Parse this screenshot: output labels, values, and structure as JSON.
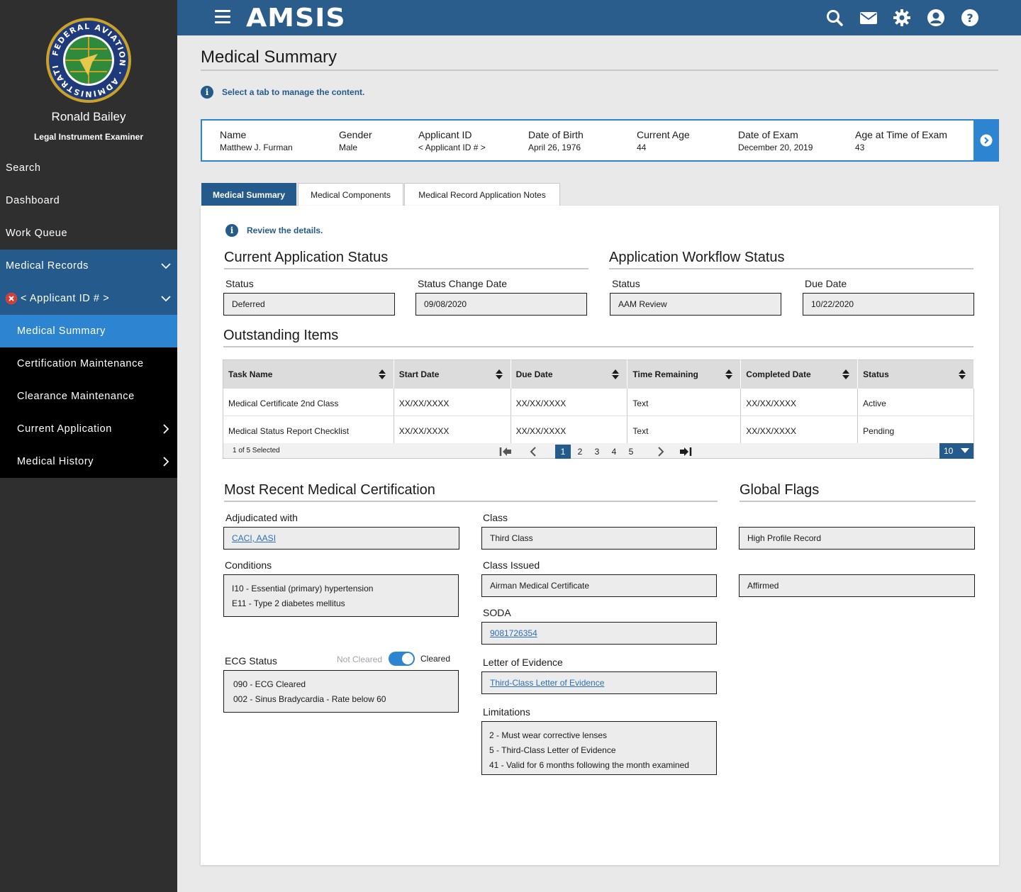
{
  "header": {
    "brand": "AMSIS"
  },
  "user": {
    "name": "Ronald Bailey",
    "role": "Legal Instrument Examiner"
  },
  "seal": {
    "text": "FEDERAL AVIATION ADMINISTRATION"
  },
  "nav": {
    "search": "Search",
    "dashboard": "Dashboard",
    "work_queue": "Work Queue",
    "medical_records": "Medical Records",
    "applicant": "< Applicant ID # >",
    "medical_summary": "Medical Summary",
    "certification_maintenance": "Certification Maintenance",
    "clearance_maintenance": "Clearance Maintenance",
    "current_application": "Current Application",
    "medical_history": "Medical History"
  },
  "page": {
    "title": "Medical Summary",
    "info": "Select a tab to manage the content."
  },
  "applicant": {
    "name_label": "Name",
    "name": "Matthew J. Furman",
    "gender_label": "Gender",
    "gender": "Male",
    "id_label": "Applicant ID",
    "id": "< Applicant ID # >",
    "dob_label": "Date of Birth",
    "dob": "April 26, 1976",
    "age_label": "Current Age",
    "age": "44",
    "exam_label": "Date of Exam",
    "exam": "December 20, 2019",
    "exam_age_label": "Age at Time of Exam",
    "exam_age": "43"
  },
  "tabs": [
    "Medical Summary",
    "Medical Components",
    "Medical Record Application Notes"
  ],
  "panel": {
    "info": "Review the details.",
    "current_status": {
      "title": "Current Application Status",
      "status_label": "Status",
      "status": "Deferred",
      "change_label": "Status Change Date",
      "change_date": "09/08/2020"
    },
    "workflow": {
      "title": "Application Workflow Status",
      "status_label": "Status",
      "status": "AAM Review",
      "due_label": "Due Date",
      "due_date": "10/22/2020"
    },
    "outstanding": {
      "title": "Outstanding Items",
      "columns": [
        "Task Name",
        "Start Date",
        "Due Date",
        "Time Remaining",
        "Completed Date",
        "Status"
      ],
      "rows": [
        [
          "Medical Certificate 2nd Class",
          "XX/XX/XXXX",
          "XX/XX/XXXX",
          "Text",
          "XX/XX/XXXX",
          "Active"
        ],
        [
          "Medical Status Report Checklist",
          "XX/XX/XXXX",
          "XX/XX/XXXX",
          "Text",
          "XX/XX/XXXX",
          "Pending"
        ]
      ],
      "selected": "1 of 5 Selected",
      "pages": [
        "1",
        "2",
        "3",
        "4",
        "5"
      ],
      "page_size": "10"
    },
    "certification": {
      "title": "Most Recent Medical Certification",
      "adjudicated_label": "Adjudicated with",
      "adjudicated": "CACI, AASI",
      "conditions_label": "Conditions",
      "conditions": [
        "I10 - Essential (primary) hypertension",
        "E11 - Type 2 diabetes mellitus"
      ],
      "ecg_label": "ECG Status",
      "toggle_off": "Not Cleared",
      "toggle_on": "Cleared",
      "ecg": [
        "090 - ECG Cleared",
        "002 - Sinus Bradycardia - Rate below 60"
      ],
      "class_label": "Class",
      "class": "Third Class",
      "class_issued_label": "Class Issued",
      "class_issued": "Airman Medical Certificate",
      "soda_label": "SODA",
      "soda": "9081726354",
      "letter_label": "Letter of Evidence",
      "letter": "Third-Class Letter of Evidence",
      "limitations_label": "Limitations",
      "limitations": [
        "2 - Must wear corrective lenses",
        "5 - Third-Class Letter of Evidence",
        "41 - Valid for 6 months following the month examined"
      ]
    },
    "flags": {
      "title": "Global Flags",
      "items": [
        "High Profile Record",
        "Affirmed"
      ]
    }
  },
  "colors": {
    "header": "#2a5c8c",
    "sidebar": "#2f2f2f",
    "active_nav": "#2d85d1",
    "section_nav": "#255a8c",
    "accent": "#2d85d1"
  },
  "icons": [
    "menu-icon",
    "search-icon",
    "mail-icon",
    "gear-icon",
    "user-icon",
    "help-icon",
    "info-icon",
    "chevron-right-icon",
    "chevron-down-icon",
    "close-icon",
    "sort-icon"
  ]
}
